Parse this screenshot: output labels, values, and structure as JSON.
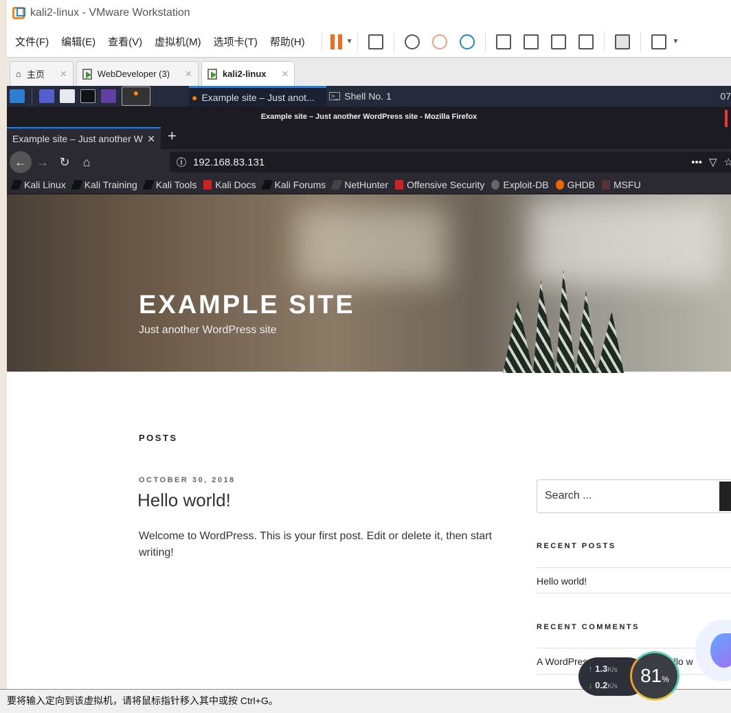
{
  "window": {
    "title": "kali2-linux - VMware Workstation"
  },
  "menu": [
    "文件(F)",
    "编辑(E)",
    "查看(V)",
    "虚拟机(M)",
    "选项卡(T)",
    "帮助(H)"
  ],
  "vm_tabs": [
    {
      "label": "主页",
      "icon": "home-icon"
    },
    {
      "label": "WebDeveloper (3)",
      "icon": "vm-icon"
    },
    {
      "label": "kali2-linux",
      "icon": "vm-icon",
      "active": true
    }
  ],
  "kali_panel": {
    "tasks": [
      "Example site – Just anot...",
      "Shell No. 1"
    ],
    "clock": "07"
  },
  "firefox": {
    "window_title": "Example site – Just another WordPress site - Mozilla Firefox",
    "tab": "Example site – Just another W",
    "url": "192.168.83.131",
    "bookmarks": [
      "Kali Linux",
      "Kali Training",
      "Kali Tools",
      "Kali Docs",
      "Kali Forums",
      "NetHunter",
      "Offensive Security",
      "Exploit-DB",
      "GHDB",
      "MSFU"
    ]
  },
  "site": {
    "title": "EXAMPLE SITE",
    "description": "Just another WordPress site",
    "posts_heading": "POSTS",
    "post": {
      "date": "OCTOBER 30, 2018",
      "title": "Hello world!",
      "body": "Welcome to WordPress. This is your first post. Edit or delete it, then start writing!"
    },
    "search_placeholder": "Search ...",
    "recent_posts_heading": "RECENT POSTS",
    "recent_posts": [
      "Hello world!"
    ],
    "recent_comments_heading": "RECENT COMMENTS",
    "recent_comments": [
      "A WordPress Commenter on Hello w"
    ]
  },
  "status_bar": "要将输入定向到该虚拟机，请将鼠标指针移入其中或按 Ctrl+G。",
  "net_widget": {
    "up": "1.3",
    "down": "0.2",
    "unit": "K/s",
    "percent": "81",
    "percent_sign": "%"
  },
  "colors": {
    "accent": "#f36b1c",
    "firefox_blue": "#0a84ff"
  }
}
